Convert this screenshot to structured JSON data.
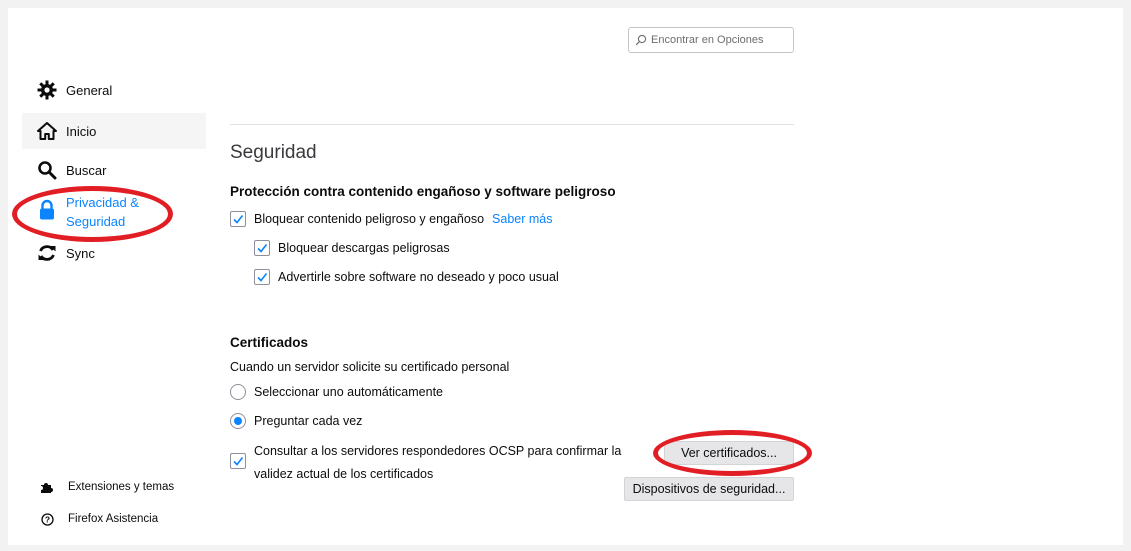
{
  "search": {
    "placeholder": "Encontrar en Opciones",
    "icon": "search-icon"
  },
  "sidebar": {
    "items": [
      {
        "label": "General",
        "icon": "gear-icon"
      },
      {
        "label": "Inicio",
        "icon": "home-icon"
      },
      {
        "label": "Buscar",
        "icon": "search-icon"
      },
      {
        "label": "Privacidad & Seguridad",
        "icon": "lock-icon",
        "selected": true
      },
      {
        "label": "Sync",
        "icon": "sync-icon"
      }
    ],
    "footer": [
      {
        "label": "Extensiones y temas",
        "icon": "puzzle-icon"
      },
      {
        "label": "Firefox Asistencia",
        "icon": "help-icon"
      }
    ]
  },
  "security": {
    "title": "Seguridad",
    "protection_heading": "Protección contra contenido engañoso y software peligroso",
    "block_dangerous": {
      "label": "Bloquear contenido peligroso y engañoso",
      "checked": true
    },
    "learn_more": "Saber más",
    "block_downloads": {
      "label": "Bloquear descargas peligrosas",
      "checked": true
    },
    "warn_software": {
      "label": "Advertirle sobre software no deseado y poco usual",
      "checked": true
    }
  },
  "certificates": {
    "heading": "Certificados",
    "description": "Cuando un servidor solicite su certificado personal",
    "select_auto": {
      "label": "Seleccionar uno automáticamente",
      "selected": false
    },
    "ask_every_time": {
      "label": "Preguntar cada vez",
      "selected": true
    },
    "ocsp": {
      "line1": "Consultar a los servidores respondedores OCSP para confirmar la",
      "line2": "validez actual de los certificados",
      "checked": true
    },
    "view_button": "Ver certificados...",
    "devices_button": "Dispositivos de seguridad..."
  },
  "colors": {
    "accent": "#0a84ff",
    "annotation": "#e21e25"
  }
}
